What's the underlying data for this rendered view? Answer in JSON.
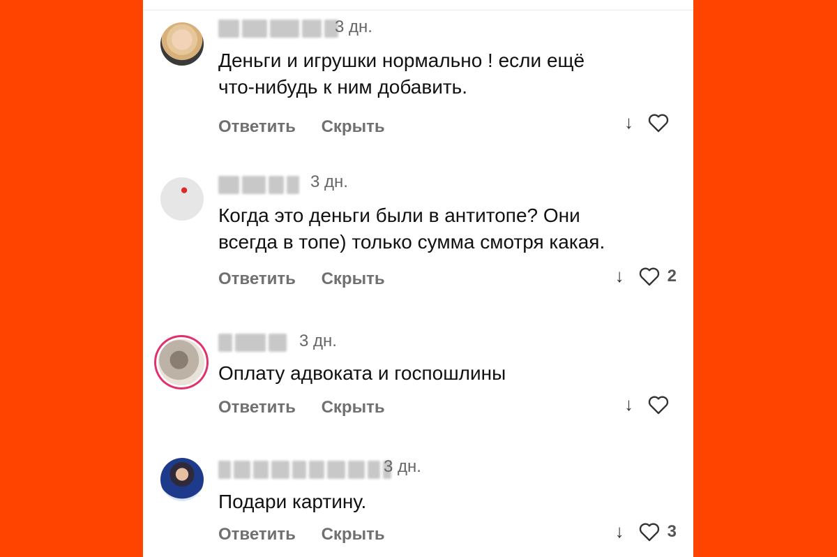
{
  "comments": [
    {
      "time": "3 дн.",
      "text": "Деньги и игрушки нормально ! если ещё\nчто-нибудь к ним добавить.",
      "reply": "Ответить",
      "hide": "Скрыть",
      "likes": ""
    },
    {
      "time": "3 дн.",
      "text": "Когда это деньги были в антитопе? Они\nвсегда в топе) только сумма смотря какая.",
      "reply": "Ответить",
      "hide": "Скрыть",
      "likes": "2"
    },
    {
      "time": "3 дн.",
      "text": "Оплату адвоката и госпошлины",
      "reply": "Ответить",
      "hide": "Скрыть",
      "likes": ""
    },
    {
      "time": "3 дн.",
      "text": "Подари картину.",
      "reply": "Ответить",
      "hide": "Скрыть",
      "likes": "3"
    }
  ],
  "colors": {
    "background": "#ff4400",
    "panel": "#ffffff",
    "text": "#111111",
    "muted": "#707070"
  },
  "icons": {
    "arrow": "down-arrow-icon",
    "heart": "heart-icon"
  }
}
